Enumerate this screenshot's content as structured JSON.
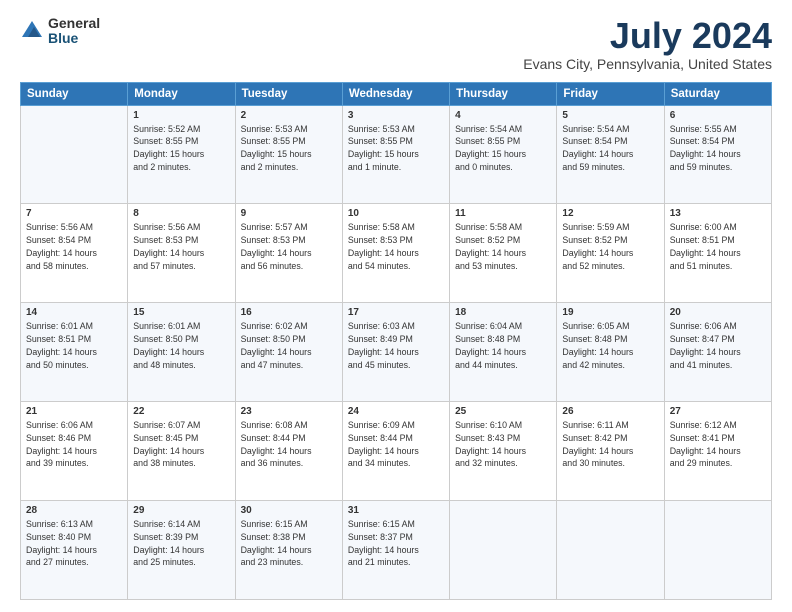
{
  "logo": {
    "general": "General",
    "blue": "Blue"
  },
  "title": {
    "month_year": "July 2024",
    "location": "Evans City, Pennsylvania, United States"
  },
  "headers": [
    "Sunday",
    "Monday",
    "Tuesday",
    "Wednesday",
    "Thursday",
    "Friday",
    "Saturday"
  ],
  "weeks": [
    [
      {
        "day": "",
        "info": ""
      },
      {
        "day": "1",
        "info": "Sunrise: 5:52 AM\nSunset: 8:55 PM\nDaylight: 15 hours\nand 2 minutes."
      },
      {
        "day": "2",
        "info": "Sunrise: 5:53 AM\nSunset: 8:55 PM\nDaylight: 15 hours\nand 2 minutes."
      },
      {
        "day": "3",
        "info": "Sunrise: 5:53 AM\nSunset: 8:55 PM\nDaylight: 15 hours\nand 1 minute."
      },
      {
        "day": "4",
        "info": "Sunrise: 5:54 AM\nSunset: 8:55 PM\nDaylight: 15 hours\nand 0 minutes."
      },
      {
        "day": "5",
        "info": "Sunrise: 5:54 AM\nSunset: 8:54 PM\nDaylight: 14 hours\nand 59 minutes."
      },
      {
        "day": "6",
        "info": "Sunrise: 5:55 AM\nSunset: 8:54 PM\nDaylight: 14 hours\nand 59 minutes."
      }
    ],
    [
      {
        "day": "7",
        "info": "Sunrise: 5:56 AM\nSunset: 8:54 PM\nDaylight: 14 hours\nand 58 minutes."
      },
      {
        "day": "8",
        "info": "Sunrise: 5:56 AM\nSunset: 8:53 PM\nDaylight: 14 hours\nand 57 minutes."
      },
      {
        "day": "9",
        "info": "Sunrise: 5:57 AM\nSunset: 8:53 PM\nDaylight: 14 hours\nand 56 minutes."
      },
      {
        "day": "10",
        "info": "Sunrise: 5:58 AM\nSunset: 8:53 PM\nDaylight: 14 hours\nand 54 minutes."
      },
      {
        "day": "11",
        "info": "Sunrise: 5:58 AM\nSunset: 8:52 PM\nDaylight: 14 hours\nand 53 minutes."
      },
      {
        "day": "12",
        "info": "Sunrise: 5:59 AM\nSunset: 8:52 PM\nDaylight: 14 hours\nand 52 minutes."
      },
      {
        "day": "13",
        "info": "Sunrise: 6:00 AM\nSunset: 8:51 PM\nDaylight: 14 hours\nand 51 minutes."
      }
    ],
    [
      {
        "day": "14",
        "info": "Sunrise: 6:01 AM\nSunset: 8:51 PM\nDaylight: 14 hours\nand 50 minutes."
      },
      {
        "day": "15",
        "info": "Sunrise: 6:01 AM\nSunset: 8:50 PM\nDaylight: 14 hours\nand 48 minutes."
      },
      {
        "day": "16",
        "info": "Sunrise: 6:02 AM\nSunset: 8:50 PM\nDaylight: 14 hours\nand 47 minutes."
      },
      {
        "day": "17",
        "info": "Sunrise: 6:03 AM\nSunset: 8:49 PM\nDaylight: 14 hours\nand 45 minutes."
      },
      {
        "day": "18",
        "info": "Sunrise: 6:04 AM\nSunset: 8:48 PM\nDaylight: 14 hours\nand 44 minutes."
      },
      {
        "day": "19",
        "info": "Sunrise: 6:05 AM\nSunset: 8:48 PM\nDaylight: 14 hours\nand 42 minutes."
      },
      {
        "day": "20",
        "info": "Sunrise: 6:06 AM\nSunset: 8:47 PM\nDaylight: 14 hours\nand 41 minutes."
      }
    ],
    [
      {
        "day": "21",
        "info": "Sunrise: 6:06 AM\nSunset: 8:46 PM\nDaylight: 14 hours\nand 39 minutes."
      },
      {
        "day": "22",
        "info": "Sunrise: 6:07 AM\nSunset: 8:45 PM\nDaylight: 14 hours\nand 38 minutes."
      },
      {
        "day": "23",
        "info": "Sunrise: 6:08 AM\nSunset: 8:44 PM\nDaylight: 14 hours\nand 36 minutes."
      },
      {
        "day": "24",
        "info": "Sunrise: 6:09 AM\nSunset: 8:44 PM\nDaylight: 14 hours\nand 34 minutes."
      },
      {
        "day": "25",
        "info": "Sunrise: 6:10 AM\nSunset: 8:43 PM\nDaylight: 14 hours\nand 32 minutes."
      },
      {
        "day": "26",
        "info": "Sunrise: 6:11 AM\nSunset: 8:42 PM\nDaylight: 14 hours\nand 30 minutes."
      },
      {
        "day": "27",
        "info": "Sunrise: 6:12 AM\nSunset: 8:41 PM\nDaylight: 14 hours\nand 29 minutes."
      }
    ],
    [
      {
        "day": "28",
        "info": "Sunrise: 6:13 AM\nSunset: 8:40 PM\nDaylight: 14 hours\nand 27 minutes."
      },
      {
        "day": "29",
        "info": "Sunrise: 6:14 AM\nSunset: 8:39 PM\nDaylight: 14 hours\nand 25 minutes."
      },
      {
        "day": "30",
        "info": "Sunrise: 6:15 AM\nSunset: 8:38 PM\nDaylight: 14 hours\nand 23 minutes."
      },
      {
        "day": "31",
        "info": "Sunrise: 6:15 AM\nSunset: 8:37 PM\nDaylight: 14 hours\nand 21 minutes."
      },
      {
        "day": "",
        "info": ""
      },
      {
        "day": "",
        "info": ""
      },
      {
        "day": "",
        "info": ""
      }
    ]
  ]
}
